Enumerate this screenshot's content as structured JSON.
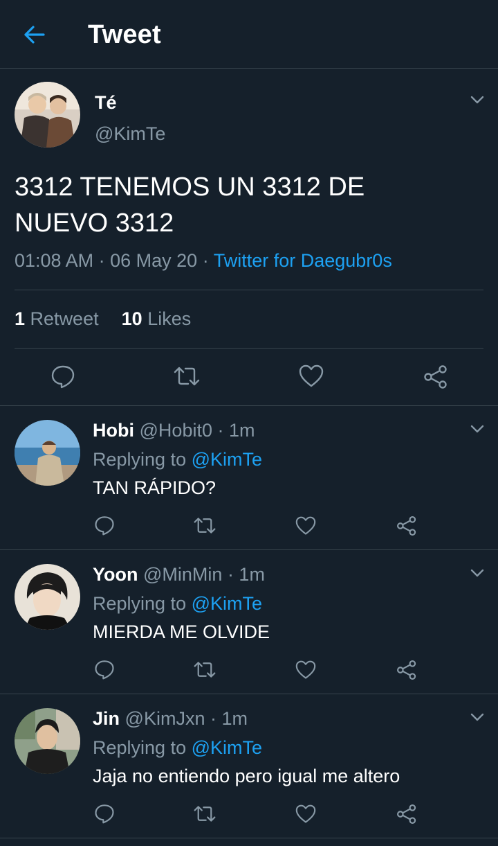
{
  "header": {
    "title": "Tweet",
    "back_icon": "arrow-left-icon"
  },
  "colors": {
    "background": "#15202b",
    "accent": "#1da1f2",
    "muted": "#8899a6",
    "divider": "#38444d"
  },
  "main_tweet": {
    "name": "Té",
    "handle": "@KimTe",
    "text_line1": "3312 TENEMOS UN 3312 DE",
    "text_line2": "NUEVO 3312",
    "time": "01:08 AM",
    "date": "06 May 20",
    "separator": "·",
    "source": "Twitter for Daegubr0s",
    "retweets_count": "1",
    "retweets_label": "Retweet",
    "likes_count": "10",
    "likes_label": "Likes"
  },
  "replies": [
    {
      "name": "Hobi",
      "handle": "@Hobit0",
      "time": "· 1m",
      "replying_label": "Replying to",
      "replying_to": "@KimTe",
      "text": "TAN RÁPIDO?"
    },
    {
      "name": "Yoon",
      "handle": "@MinMin",
      "time": "· 1m",
      "replying_label": "Replying to",
      "replying_to": "@KimTe",
      "text": "MIERDA ME OLVIDE"
    },
    {
      "name": "Jin",
      "handle": "@KimJxn",
      "time": "· 1m",
      "replying_label": "Replying to",
      "replying_to": "@KimTe",
      "text": "Jaja no entiendo pero igual me altero"
    }
  ]
}
